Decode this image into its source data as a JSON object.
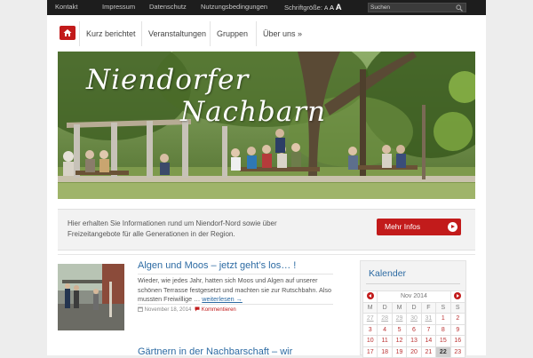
{
  "topbar": {
    "links": [
      "Kontakt",
      "Impressum",
      "Datenschutz",
      "Nutzungsbedingungen"
    ],
    "font_size_label": "Schriftgröße:",
    "font_sizes": [
      "A",
      "A",
      "A"
    ],
    "search_placeholder": "Suchen"
  },
  "nav": {
    "items": [
      "Kurz berichtet",
      "Veranstaltungen",
      "Gruppen",
      "Über uns »"
    ]
  },
  "hero": {
    "line1": "Niendorfer",
    "line2": "Nachbarn"
  },
  "intro": {
    "text": "Hier erhalten Sie Informationen rund um Niendorf-Nord sowie über Freizeitangebote für alle Generationen in der Region.",
    "button": "Mehr Infos"
  },
  "posts": [
    {
      "title": "Algen und Moos – jetzt geht’s los… !",
      "excerpt": "Wieder, wie jedes Jahr, hatten sich Moos und Algen auf unserer schönen Terrasse festgesetzt und machten sie zur Rutschbahn. Also mussten Freiwillige …",
      "read_more": "weiterlesen →",
      "date": "November 18, 2014",
      "comments": "Kommentieren"
    },
    {
      "title": "Gärtnern in der Nachbarschaft – wir"
    }
  ],
  "calendar": {
    "widget_title": "Kalender",
    "month": "Nov 2014",
    "weekdays": [
      "M",
      "D",
      "M",
      "D",
      "F",
      "S",
      "S"
    ],
    "weeks": [
      [
        "27",
        "28",
        "29",
        "30",
        "31",
        "1",
        "2"
      ],
      [
        "3",
        "4",
        "5",
        "6",
        "7",
        "8",
        "9"
      ],
      [
        "10",
        "11",
        "12",
        "13",
        "14",
        "15",
        "16"
      ],
      [
        "17",
        "18",
        "19",
        "20",
        "21",
        "22",
        "23"
      ]
    ],
    "today": "22"
  },
  "colors": {
    "accent_red": "#c21b1b",
    "link_blue": "#2d6ba3",
    "topbar_bg": "#1d1d1d"
  }
}
